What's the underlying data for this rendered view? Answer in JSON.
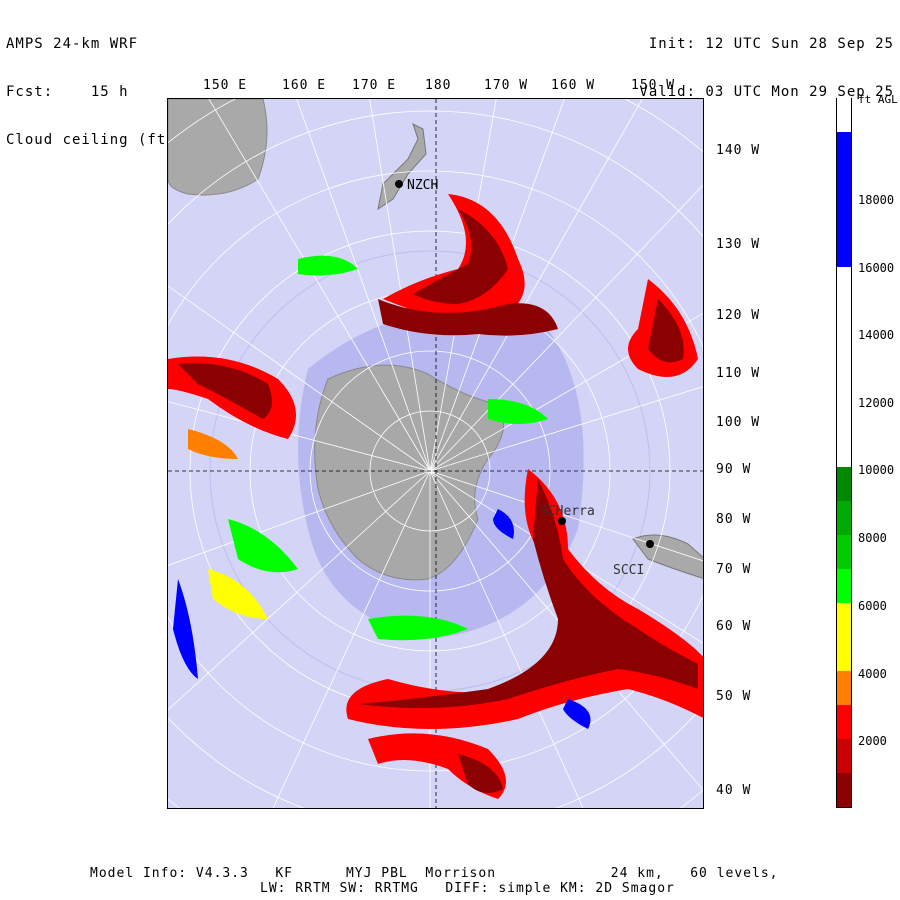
{
  "header": {
    "model": "AMPS 24-km WRF",
    "fcst_label": "Fcst:",
    "fcst_value": "15 h",
    "field": "Cloud ceiling (ft AGL)",
    "init": "Init: 12 UTC Sun 28 Sep 25",
    "valid": "Valid: 03 UTC Mon 29 Sep 25"
  },
  "map": {
    "longitude_labels": [
      "150 E",
      "160 E",
      "170 E",
      "180",
      "170 W",
      "160 W",
      "150 W"
    ],
    "latitude_labels": [
      "140 W",
      "130 W",
      "120 W",
      "110 W",
      "100 W",
      "90 W",
      "80 W",
      "70 W",
      "60 W",
      "50 W",
      "40 W"
    ],
    "stations": [
      {
        "name": "NZCH"
      },
      {
        "name": "SCHerra"
      },
      {
        "name": "SCCI"
      }
    ],
    "colors": {
      "ocean": "#d4d4f6",
      "sea_ice": "#b4b4ee",
      "land": "#a9a9a9",
      "grid": "#ffffff"
    }
  },
  "colorbar": {
    "title": "ft AGL",
    "tick_labels": [
      "18000",
      "16000",
      "14000",
      "12000",
      "10000",
      "8000",
      "6000",
      "4000",
      "2000"
    ],
    "bins": [
      {
        "range": "0-1000",
        "color": "#8b0000"
      },
      {
        "range": "1000-2000",
        "color": "#cc0000"
      },
      {
        "range": "2000-3000",
        "color": "#ff0000"
      },
      {
        "range": "3000-4000",
        "color": "#ff7f00"
      },
      {
        "range": "4000-5000",
        "color": "#ffff00"
      },
      {
        "range": "5000-6000",
        "color": "#ffff00"
      },
      {
        "range": "6000-7000",
        "color": "#00ff00"
      },
      {
        "range": "7000-8000",
        "color": "#00cc00"
      },
      {
        "range": "8000-9000",
        "color": "#00aa00"
      },
      {
        "range": "9000-10000",
        "color": "#008800"
      },
      {
        "range": "10000-16000",
        "color": "#ffffff"
      },
      {
        "range": "16000-20000",
        "color": "#0000ff"
      },
      {
        "range": ">20000",
        "color": "#ffffff"
      }
    ]
  },
  "footer": {
    "line1": "Model Info: V4.3.3   KF      MYJ PBL  Morrison             24 km,   60 levels,",
    "line2": "LW: RRTM SW: RRTMG   DIFF: simple KM: 2D Smagor"
  }
}
